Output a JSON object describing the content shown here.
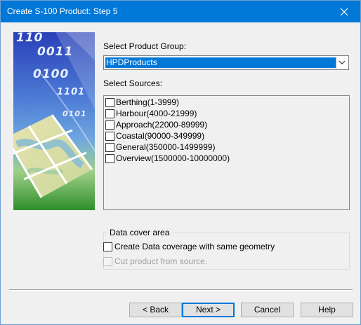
{
  "window": {
    "title": "Create S-100 Product: Step 5"
  },
  "side_image": {
    "bits": [
      "110",
      "0011",
      "0100",
      "1101",
      "0101"
    ]
  },
  "product_group": {
    "label": "Select Product Group:",
    "value": "HPDProducts"
  },
  "sources": {
    "label": "Select Sources:",
    "items": [
      {
        "label": "Berthing(1-3999)",
        "checked": false
      },
      {
        "label": "Harbour(4000-21999)",
        "checked": false
      },
      {
        "label": "Approach(22000-89999)",
        "checked": false
      },
      {
        "label": "Coastal(90000-349999)",
        "checked": false
      },
      {
        "label": "General(350000-1499999)",
        "checked": false
      },
      {
        "label": "Overview(1500000-10000000)",
        "checked": false
      }
    ]
  },
  "data_cover": {
    "title": "Data cover area",
    "create_same_geometry": "Create Data coverage with same geometry",
    "cut_product": "Cut product from source."
  },
  "buttons": {
    "back": "< Back",
    "next": "Next >",
    "cancel": "Cancel",
    "help": "Help"
  },
  "colors": {
    "titlebar": "#0078d7",
    "selection": "#0078d7"
  }
}
